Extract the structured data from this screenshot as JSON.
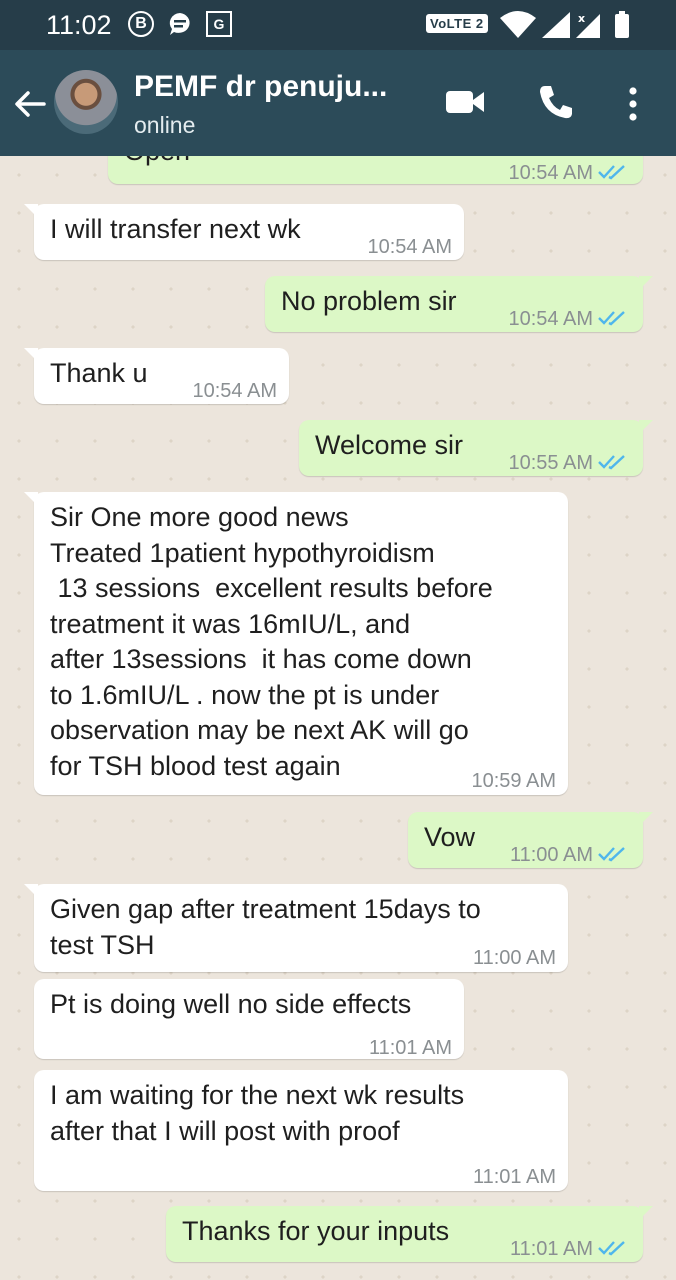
{
  "status_bar": {
    "time": "11:02",
    "b_icon": "B",
    "network_badge": "VoLTE 2"
  },
  "header": {
    "contact_name": "PEMF dr penuju...",
    "status": "online"
  },
  "messages": [
    {
      "dir": "out",
      "text": "Open",
      "time": "10:54 AM",
      "read": true
    },
    {
      "dir": "in",
      "text": "I will transfer next wk",
      "time": "10:54 AM"
    },
    {
      "dir": "out",
      "text": "No problem sir",
      "time": "10:54 AM",
      "read": true
    },
    {
      "dir": "in",
      "text": "Thank u",
      "time": "10:54 AM"
    },
    {
      "dir": "out",
      "text": "Welcome sir",
      "time": "10:55 AM",
      "read": true
    },
    {
      "dir": "in",
      "text": "Sir One more good news\nTreated 1patient hypothyroidism\n 13 sessions  excellent results before\ntreatment it was 16mIU/L, and\nafter 13sessions  it has come down\nto 1.6mIU/L . now the pt is under\nobservation may be next AK will go\nfor TSH blood test again",
      "time": "10:59 AM"
    },
    {
      "dir": "out",
      "text": "Vow",
      "time": "11:00 AM",
      "read": true
    },
    {
      "dir": "in",
      "text": "Given gap after treatment 15days to\ntest TSH",
      "time": "11:00 AM"
    },
    {
      "dir": "in",
      "text": "Pt is doing well no side effects",
      "time": "11:01 AM"
    },
    {
      "dir": "in",
      "text": "I am waiting for the next wk results\nafter that I will post with proof",
      "time": "11:01 AM"
    },
    {
      "dir": "out",
      "text": "Thanks for your inputs",
      "time": "11:01 AM",
      "read": true
    }
  ],
  "colors": {
    "status_bar_bg": "#263d49",
    "app_bar_bg": "#2c4b59",
    "incoming_bubble": "#ffffff",
    "outgoing_bubble": "#dcf8c6",
    "read_tick": "#4fb6ec"
  },
  "icons": [
    "back-arrow-icon",
    "video-call-icon",
    "phone-icon",
    "more-options-icon",
    "wifi-icon",
    "signal-icon",
    "battery-icon",
    "message-icon",
    "translate-icon"
  ]
}
